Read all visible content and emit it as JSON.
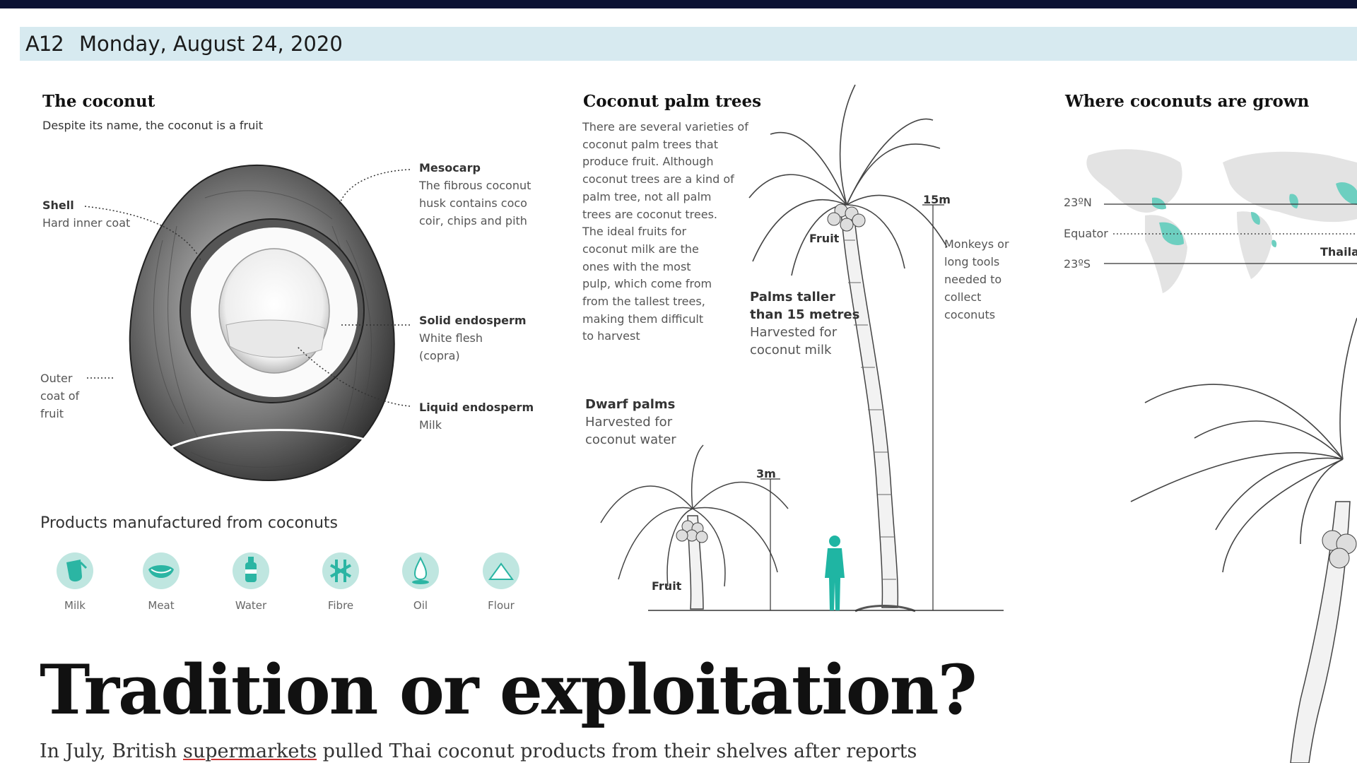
{
  "header": {
    "page_number": "A12",
    "date": "Monday, August 24, 2020"
  },
  "coconut": {
    "title": "The coconut",
    "subtitle": "Despite its name, the coconut is a fruit",
    "labels": {
      "shell_title": "Shell",
      "shell_text": "Hard inner coat",
      "mesocarp_title": "Mesocarp",
      "mesocarp_text_1": "The fibrous coconut",
      "mesocarp_text_2": "husk contains coco",
      "mesocarp_text_3": "coir, chips and pith",
      "solid_title": "Solid endosperm",
      "solid_text_1": "White flesh",
      "solid_text_2": "(copra)",
      "liquid_title": "Liquid endosperm",
      "liquid_text": "Milk",
      "outer_1": "Outer",
      "outer_2": "coat of",
      "outer_3": "fruit"
    }
  },
  "products": {
    "title": "Products manufactured from coconuts",
    "items": [
      {
        "label": "Milk",
        "icon": "milk-icon"
      },
      {
        "label": "Meat",
        "icon": "meat-icon"
      },
      {
        "label": "Water",
        "icon": "water-bottle-icon"
      },
      {
        "label": "Fibre",
        "icon": "fibre-icon"
      },
      {
        "label": "Oil",
        "icon": "oil-drop-icon"
      },
      {
        "label": "Flour",
        "icon": "flour-icon"
      }
    ],
    "icon_bg": "#bfe6e0",
    "icon_fg": "#2bb5a3"
  },
  "palms": {
    "title": "Coconut palm trees",
    "body": [
      "There are several varieties of",
      "coconut palm trees that",
      "produce fruit. Although",
      "coconut trees are a kind of",
      "palm tree, not all palm",
      "trees are coconut trees.",
      "The ideal fruits for",
      "coconut milk are the",
      "ones with the most",
      "pulp, which come from",
      "from the tallest trees,",
      "making them difficult",
      "to harvest"
    ],
    "tall_title_1": "Palms taller",
    "tall_title_2": "than 15 metres",
    "tall_text_1": "Harvested for",
    "tall_text_2": "coconut milk",
    "fruit_tall": "Fruit",
    "fruit_dwarf": "Fruit",
    "height_tall": "15m",
    "height_dwarf": "3m",
    "monkeys": [
      "Monkeys or",
      "long tools",
      "needed to",
      "collect",
      "coconuts"
    ],
    "dwarf_title": "Dwarf palms",
    "dwarf_text_1": "Harvested for",
    "dwarf_text_2": "coconut water",
    "accent": "#1fb5a3"
  },
  "map": {
    "title": "Where coconuts are grown",
    "lat_north": "23ºN",
    "equator": "Equator",
    "lat_south": "23ºS",
    "country_label": "Thailan",
    "land_color": "#e3e3e3",
    "grown_color": "#6dcfc0"
  },
  "article": {
    "headline": "Tradition or exploitation?",
    "standfirst_a": "In July, British ",
    "standfirst_link": "supermarkets",
    "standfirst_b": " pulled Thai coconut products from their shelves after reports"
  }
}
